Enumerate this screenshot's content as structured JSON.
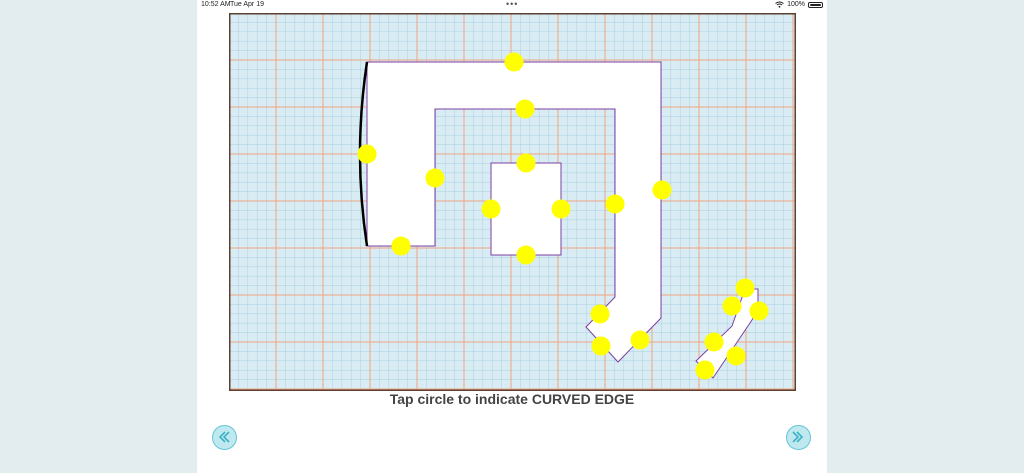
{
  "status_bar": {
    "time": "10:52 AM",
    "date": "Tue Apr 19",
    "multitask_dots": "•••",
    "battery": "100%"
  },
  "instruction": "Tap circle to indicate CURVED EDGE",
  "nav": {
    "prev_icon": "chevron-double-left-icon",
    "next_icon": "chevron-double-right-icon"
  },
  "colors": {
    "grid_fill": "#d9ecf3",
    "grid_minor": "#a9d1e3",
    "grid_major": "#f0a582",
    "shape_outline": "#7b3fa0",
    "curved_edge": "#000000",
    "circle": "#ffff00",
    "nav_fill": "#bfe8ef",
    "nav_border": "#62c6d6"
  }
}
